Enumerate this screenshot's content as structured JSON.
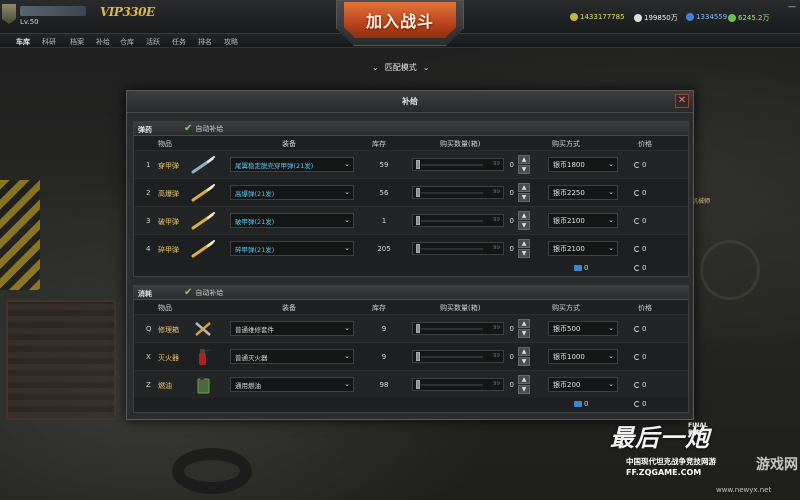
{
  "player": {
    "level": "Lv.50",
    "vip": "VIP330E"
  },
  "nav": [
    "车库",
    "科研",
    "档案",
    "补给",
    "仓库",
    "活跃",
    "任务",
    "排名",
    "攻略"
  ],
  "battle_button": "加入战斗",
  "match_mode": "匹配模式",
  "currency": [
    {
      "value": "1433177785",
      "class": "cur-gold",
      "icon": "gold-coin-icon"
    },
    {
      "value": "199850万",
      "class": "cur-silver",
      "icon": "silver-coin-icon"
    },
    {
      "value": "1334559",
      "class": "cur-blue",
      "icon": "card-icon"
    },
    {
      "value": "6245.2万",
      "class": "cur-green",
      "icon": "star-icon"
    }
  ],
  "background_label": "机械师",
  "dialog": {
    "title": "补给",
    "columns": {
      "item": "物品",
      "equip": "装备",
      "stock": "库存",
      "qty": "购买数量(箱)",
      "pay": "购买方式",
      "price": "价格"
    },
    "ammo": {
      "title": "弹药",
      "auto": "自动补给",
      "rows": [
        {
          "idx": "1",
          "name": "穿甲弹",
          "equip": "尾翼稳定脱壳穿甲弹(21发)",
          "stock": "59",
          "max": "99",
          "qty": "0",
          "pay": "银币1800",
          "price": "0",
          "icon": "ap-shell-icon",
          "equip_color": "blue"
        },
        {
          "idx": "2",
          "name": "高爆弹",
          "equip": "高爆弹(21发)",
          "stock": "56",
          "max": "99",
          "qty": "0",
          "pay": "银币2250",
          "price": "0",
          "icon": "he-shell-icon",
          "equip_color": "blue"
        },
        {
          "idx": "3",
          "name": "破甲弹",
          "equip": "破甲弹(21发)",
          "stock": "1",
          "max": "99",
          "qty": "0",
          "pay": "银币2100",
          "price": "0",
          "icon": "heat-shell-icon",
          "equip_color": "blue"
        },
        {
          "idx": "4",
          "name": "碎甲弹",
          "equip": "碎甲弹(21发)",
          "stock": "205",
          "max": "99",
          "qty": "0",
          "pay": "银币2100",
          "price": "0",
          "icon": "hesh-shell-icon",
          "equip_color": "blue"
        }
      ],
      "total_card": "0",
      "total_coin": "0"
    },
    "consumables": {
      "title": "消耗",
      "auto": "自动补给",
      "rows": [
        {
          "idx": "Q",
          "name": "修理箱",
          "equip": "普通维修套件",
          "stock": "9",
          "max": "99",
          "qty": "0",
          "pay": "银币500",
          "price": "0",
          "icon": "repair-kit-icon",
          "equip_color": "gray"
        },
        {
          "idx": "X",
          "name": "灭火器",
          "equip": "普通灭火器",
          "stock": "9",
          "max": "99",
          "qty": "0",
          "pay": "银币1000",
          "price": "0",
          "icon": "extinguisher-icon",
          "equip_color": "gray"
        },
        {
          "idx": "Z",
          "name": "燃油",
          "equip": "通用燃油",
          "stock": "98",
          "max": "99",
          "qty": "0",
          "pay": "银币200",
          "price": "0",
          "icon": "fuel-can-icon",
          "equip_color": "gray"
        }
      ],
      "total_card": "0",
      "total_coin": "0"
    }
  },
  "logo": {
    "main": "最后一炮",
    "final_fire": "FINAL\nFIRE",
    "subtitle": "中国现代坦克战争竞技网游",
    "site": "FF.ZQGAME.COM"
  },
  "watermark": {
    "text": "游戏网",
    "site": "www.newyx.net"
  }
}
